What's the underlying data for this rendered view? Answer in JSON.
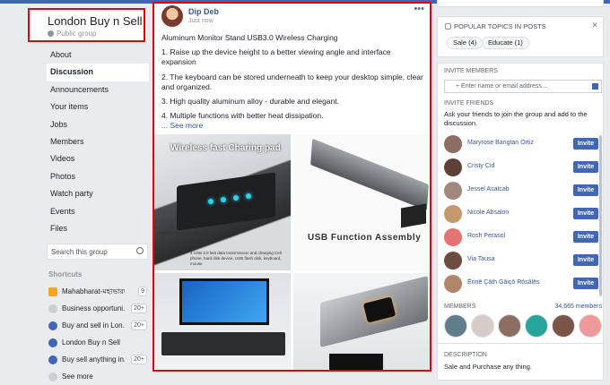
{
  "group": {
    "name": "London Buy n Sell",
    "privacy": "Public group"
  },
  "nav": [
    "About",
    "Discussion",
    "Announcements",
    "Your items",
    "Jobs",
    "Members",
    "Videos",
    "Photos",
    "Watch party",
    "Events",
    "Files"
  ],
  "nav_active": "Discussion",
  "search": {
    "placeholder": "Search this group"
  },
  "shortcuts": {
    "title": "Shortcuts",
    "items": [
      {
        "label": "Mahabharat-মহাভারত",
        "count": "9"
      },
      {
        "label": "Business opportuni...",
        "count": "20+"
      },
      {
        "label": "Buy and sell in Lon...",
        "count": "20+"
      },
      {
        "label": "London Buy n Sell",
        "count": ""
      },
      {
        "label": "Buy sell anything in...",
        "count": "20+"
      },
      {
        "label": "See more",
        "count": ""
      }
    ]
  },
  "post": {
    "author": "Dip Deb",
    "time": "Just now",
    "more_icon": "•••",
    "paragraphs": [
      "Aluminum Monitor Stand USB3.0 Wireless Charging",
      "1. Raise up the device height to a better viewing angle and interface expansion",
      "2. The keyboard can be stored underneath to keep your desktop simple, clear and organized.",
      "3. High quality aluminum alloy - durable and elegant.",
      "4. Multiple functions with better heat dissipation."
    ],
    "see_more": "... See more",
    "images": {
      "img1_caption": "Wireless fast Charing pad",
      "img1_label": "wireless fast Charing pad",
      "img1_note": "4 USB 3.0 fast data transmission and charging Cell phone, hard disk device, USB flash disk, keyboard, mouse",
      "img2_caption": "USB Function Assembly"
    }
  },
  "topics": {
    "title": "POPULAR TOPICS IN POSTS",
    "chips": [
      "Sale (4)",
      "Educate (1)"
    ],
    "close_icon": "×"
  },
  "invite": {
    "members_title": "INVITE MEMBERS",
    "placeholder": "+ Enter name or email address...",
    "friends_title": "INVITE FRIENDS",
    "description": "Ask your friends to join the group and add to the discussion.",
    "button_label": "Invite",
    "friends": [
      {
        "name": "Maryrose Bangtan Ortiz",
        "color": "#8d6e63"
      },
      {
        "name": "Cristy Cid",
        "color": "#5d4037"
      },
      {
        "name": "Jessel Asatcab",
        "color": "#a1887f"
      },
      {
        "name": "Nicole Absalon",
        "color": "#c49a6c"
      },
      {
        "name": "Rosh Perasol",
        "color": "#e57373"
      },
      {
        "name": "Via Tausa",
        "color": "#6d4c41"
      },
      {
        "name": "Ērinē Çāth Gāiçō Rōsālēs",
        "color": "#b0856a"
      }
    ]
  },
  "members": {
    "title": "MEMBERS",
    "count": "34,665 members",
    "avatar_colors": [
      "#607d8b",
      "#d7ccc8",
      "#8d6e63",
      "#26a69a",
      "#795548",
      "#ef9a9a"
    ]
  },
  "description": {
    "title": "DESCRIPTION",
    "text": "Sale and Purchase any thing."
  }
}
